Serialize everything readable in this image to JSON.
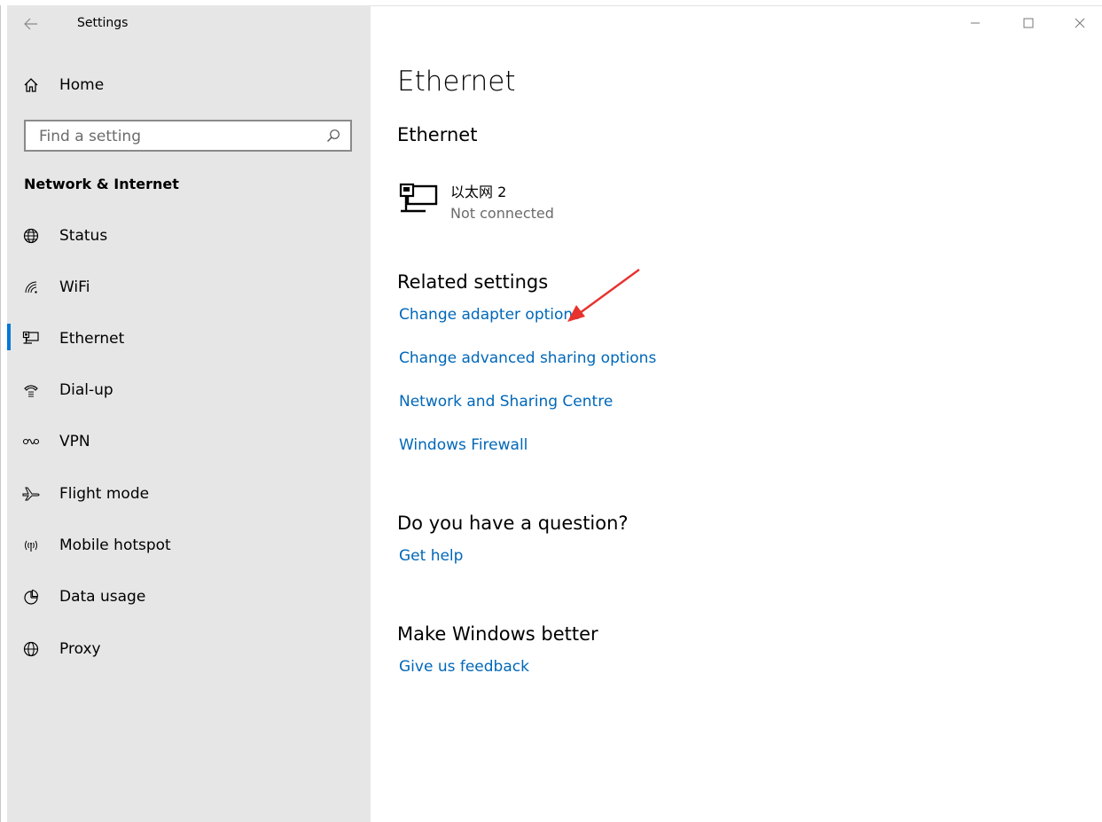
{
  "window": {
    "title": "Settings",
    "back_icon": "back-arrow-icon",
    "minimize_icon": "minimize-icon",
    "maximize_icon": "maximize-icon",
    "close_icon": "close-icon"
  },
  "sidebar": {
    "home_label": "Home",
    "search_placeholder": "Find a setting",
    "section_title": "Network & Internet",
    "accent_color": "#0078d7",
    "items": [
      {
        "label": "Status",
        "icon": "globe-status-icon",
        "active": false
      },
      {
        "label": "WiFi",
        "icon": "wifi-icon",
        "active": false
      },
      {
        "label": "Ethernet",
        "icon": "ethernet-icon",
        "active": true
      },
      {
        "label": "Dial-up",
        "icon": "dial-up-icon",
        "active": false
      },
      {
        "label": "VPN",
        "icon": "vpn-icon",
        "active": false
      },
      {
        "label": "Flight mode",
        "icon": "airplane-icon",
        "active": false
      },
      {
        "label": "Mobile hotspot",
        "icon": "hotspot-icon",
        "active": false
      },
      {
        "label": "Data usage",
        "icon": "pie-chart-icon",
        "active": false
      },
      {
        "label": "Proxy",
        "icon": "globe-proxy-icon",
        "active": false
      }
    ]
  },
  "main": {
    "page_title": "Ethernet",
    "section_title": "Ethernet",
    "adapter": {
      "name": "以太网 2",
      "status": "Not connected",
      "icon": "ethernet-adapter-icon"
    },
    "related": {
      "title": "Related settings",
      "links": [
        "Change adapter options",
        "Change advanced sharing options",
        "Network and Sharing Centre",
        "Windows Firewall"
      ]
    },
    "question": {
      "title": "Do you have a question?",
      "link": "Get help"
    },
    "better": {
      "title": "Make Windows better",
      "link": "Give us feedback"
    },
    "link_color": "#0067b8"
  }
}
